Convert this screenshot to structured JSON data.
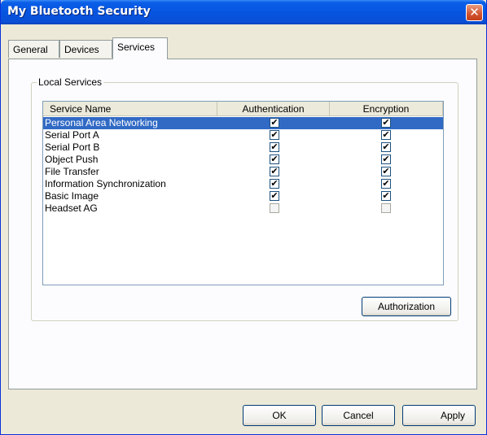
{
  "window": {
    "title": "My Bluetooth Security",
    "close_glyph": "✕"
  },
  "tabs": [
    {
      "label": "General",
      "active": false
    },
    {
      "label": "Devices",
      "active": false
    },
    {
      "label": "Services",
      "active": true
    }
  ],
  "local_services": {
    "group_label": "Local Services",
    "columns": [
      "Service Name",
      "Authentication",
      "Encryption"
    ],
    "rows": [
      {
        "name": "Personal Area Networking",
        "authentication": "✔",
        "encryption": "✔",
        "selected": true
      },
      {
        "name": "Serial Port A",
        "authentication": "✔",
        "encryption": "✔",
        "selected": false
      },
      {
        "name": "Serial Port B",
        "authentication": "✔",
        "encryption": "✔",
        "selected": false
      },
      {
        "name": "Object Push",
        "authentication": "✔",
        "encryption": "✔",
        "selected": false
      },
      {
        "name": "File Transfer",
        "authentication": "✔",
        "encryption": "✔",
        "selected": false
      },
      {
        "name": "Information Synchronization",
        "authentication": "✔",
        "encryption": "✔",
        "selected": false
      },
      {
        "name": "Basic Image",
        "authentication": "✔",
        "encryption": "✔",
        "selected": false
      },
      {
        "name": "Headset AG",
        "authentication": "",
        "encryption": "",
        "selected": false
      }
    ],
    "authorization_label": "Authorization"
  },
  "footer": {
    "ok_label": "OK",
    "cancel_label": "Cancel",
    "apply_label": "Apply"
  }
}
